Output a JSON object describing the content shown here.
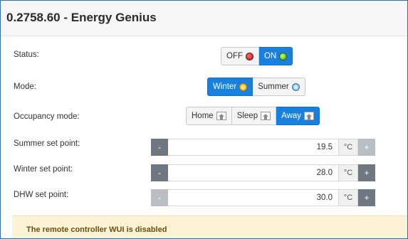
{
  "window": {
    "title": "0.2758.60 - Energy Genius"
  },
  "status": {
    "label": "Status:",
    "options": [
      {
        "label": "OFF",
        "icon": "red-dot-icon",
        "active": false
      },
      {
        "label": "ON",
        "icon": "green-dot-icon",
        "active": true
      }
    ]
  },
  "mode": {
    "label": "Mode:",
    "options": [
      {
        "label": "Winter",
        "icon": "sun-icon",
        "active": true
      },
      {
        "label": "Summer",
        "icon": "snowflake-icon",
        "active": false
      }
    ]
  },
  "occupancy": {
    "label": "Occupancy mode:",
    "options": [
      {
        "label": "Home",
        "icon": "home-icon",
        "active": false
      },
      {
        "label": "Sleep",
        "icon": "home-icon",
        "active": false
      },
      {
        "label": "Away",
        "icon": "home-icon",
        "active": true
      }
    ]
  },
  "setpoints": [
    {
      "label": "Summer set point:",
      "value": "19.5",
      "unit": "°C",
      "minus": "-",
      "plus": "+",
      "enabled": false
    },
    {
      "label": "Winter set point:",
      "value": "28.0",
      "unit": "°C",
      "minus": "-",
      "plus": "+",
      "enabled": true
    },
    {
      "label": "DHW set point:",
      "value": "30.0",
      "unit": "°C",
      "minus": "-",
      "plus": "+",
      "enabled": true
    }
  ],
  "notice": {
    "text": "The remote controller WUI is disabled"
  },
  "colors": {
    "accent": "#1a80e0",
    "notice_bg": "#fcf3d5",
    "spinner_dark": "#6f7780",
    "spinner_light": "#b8bec4"
  }
}
